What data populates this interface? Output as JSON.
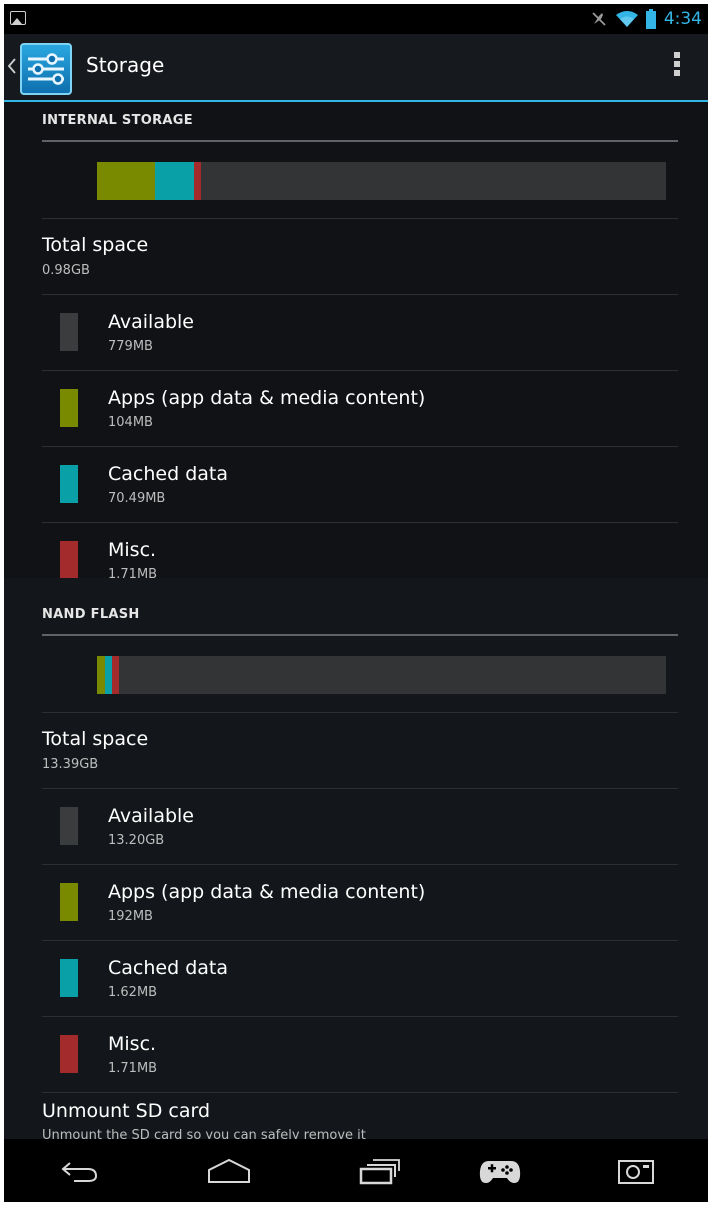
{
  "status_bar": {
    "time": "4:34",
    "icons": [
      "gallery-notification-icon",
      "muted-icon",
      "wifi-icon",
      "battery-icon"
    ]
  },
  "action_bar": {
    "title": "Storage",
    "icons": [
      "settings-sliders-icon",
      "overflow-menu-icon"
    ]
  },
  "colors": {
    "available": "#3a3c3e",
    "apps": "#7a8a00",
    "cached": "#0aa0a8",
    "misc": "#a32b2b",
    "accent": "#33b5e5"
  },
  "internal_storage": {
    "header": "INTERNAL STORAGE",
    "bar": {
      "apps": 0.102,
      "cached": 0.069,
      "misc": 0.012
    },
    "total_label": "Total space",
    "total_value": "0.98GB",
    "items": [
      {
        "key": "available",
        "label": "Available",
        "value": "779MB"
      },
      {
        "key": "apps",
        "label": "Apps (app data & media content)",
        "value": "104MB"
      },
      {
        "key": "cached",
        "label": "Cached data",
        "value": "70.49MB"
      },
      {
        "key": "misc",
        "label": "Misc.",
        "value": "1.71MB"
      }
    ]
  },
  "nand_flash": {
    "header": "NAND FLASH",
    "bar": {
      "apps": 0.014,
      "cached": 0.012,
      "misc": 0.012
    },
    "total_label": "Total space",
    "total_value": "13.39GB",
    "items": [
      {
        "key": "available",
        "label": "Available",
        "value": "13.20GB"
      },
      {
        "key": "apps",
        "label": "Apps (app data & media content)",
        "value": "192MB"
      },
      {
        "key": "cached",
        "label": "Cached data",
        "value": "1.62MB"
      },
      {
        "key": "misc",
        "label": "Misc.",
        "value": "1.71MB"
      }
    ]
  },
  "unmount": {
    "title": "Unmount SD card",
    "subtitle": "Unmount the SD card so you can safely remove it"
  },
  "nav_bar": {
    "icons": [
      "back-icon",
      "home-icon",
      "recent-apps-icon",
      "game-controller-icon",
      "screenshot-icon"
    ]
  }
}
